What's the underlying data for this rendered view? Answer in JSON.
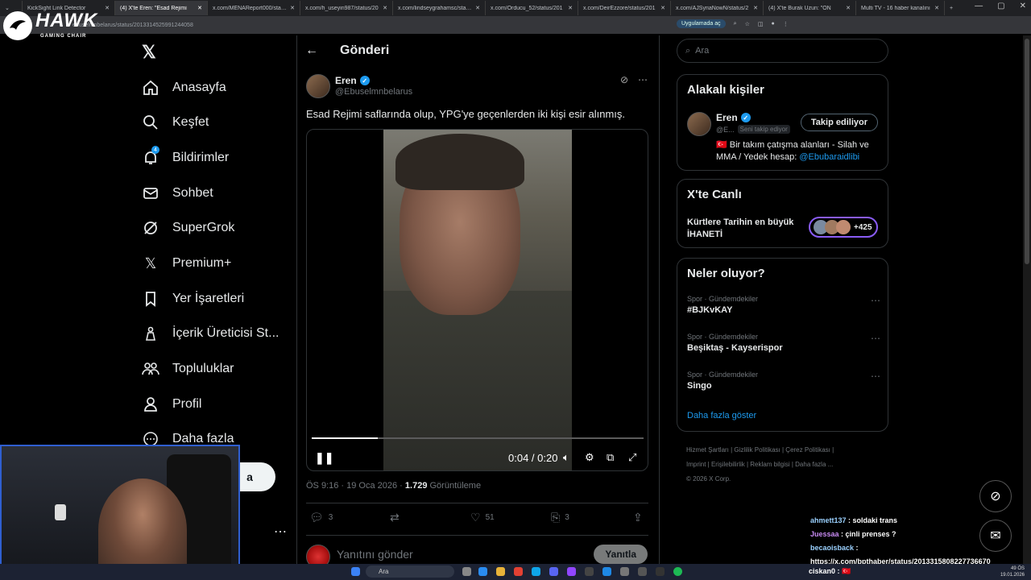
{
  "browser": {
    "tabs": [
      {
        "title": "KickSight Link Detector",
        "active": false
      },
      {
        "title": "(4) X'te Eren: \"Esad Rejimi",
        "active": true
      },
      {
        "title": "x.com/MENAReport000/status",
        "active": false
      },
      {
        "title": "x.com/h_useyin987/status/20",
        "active": false
      },
      {
        "title": "x.com/lindseygrahamsc/status",
        "active": false
      },
      {
        "title": "x.com/Orducu_52/status/201",
        "active": false
      },
      {
        "title": "x.com/DeirEzzore/status/201",
        "active": false
      },
      {
        "title": "x.com/AJSyriaNowN/status/2",
        "active": false
      },
      {
        "title": "(4) X'te Burak Uzun: \"ÖN",
        "active": false
      },
      {
        "title": "Multi TV - 16 haber kanalını",
        "active": false
      }
    ],
    "url": "ebuselmnbelarus/status/2013314525991244058",
    "app_button": "Uygulamada aç"
  },
  "overlay": {
    "brand": "HAWK",
    "brand_sub": "GAMING CHAIR"
  },
  "sidebar": {
    "items": [
      {
        "label": "Anasayfa",
        "icon": "home-icon"
      },
      {
        "label": "Keşfet",
        "icon": "search-icon"
      },
      {
        "label": "Bildirimler",
        "icon": "bell-icon",
        "badge": "4"
      },
      {
        "label": "Sohbet",
        "icon": "mail-icon"
      },
      {
        "label": "SuperGrok",
        "icon": "grok-icon"
      },
      {
        "label": "Premium+",
        "icon": "x-icon"
      },
      {
        "label": "Yer İşaretleri",
        "icon": "bookmark-icon"
      },
      {
        "label": "İçerik Üreticisi St...",
        "icon": "creator-icon"
      },
      {
        "label": "Topluluklar",
        "icon": "communities-icon"
      },
      {
        "label": "Profil",
        "icon": "person-icon"
      },
      {
        "label": "Daha fazla",
        "icon": "more-icon"
      }
    ],
    "post_button": "a"
  },
  "main": {
    "header": "Gönderi",
    "author_name": "Eren",
    "author_handle": "@Ebuselmnbelarus",
    "text": "Esad Rejimi saflarında olup, YPG'ye geçenlerden iki kişi esir alınmış.",
    "video_time": "0:04 / 0:20",
    "video_progress": 0.2,
    "meta_time": "ÖS 9:16 · 19 Oca 2026 · ",
    "views": "1.729",
    "views_label": " Görüntüleme",
    "stats": {
      "replies": "3",
      "reposts": "",
      "likes": "51",
      "bookmarks": "3"
    },
    "reply_placeholder": "Yanıtını gönder",
    "reply_button": "Yanıtla"
  },
  "right": {
    "search_placeholder": "Ara",
    "related": {
      "title": "Alakalı kişiler",
      "name": "Eren",
      "handle": "@E...",
      "follows_you": "Seni takip ediyor",
      "button": "Takip ediliyor",
      "bio": "🇹🇷 Bir takım çatışma alanları - Silah ve MMA / Yedek hesap: ",
      "bio_link": "@Ebubaraidlibi"
    },
    "live": {
      "title": "X'te Canlı",
      "line1": "Kürtlere Tarihin en büyük",
      "line2": "İHANETİ",
      "count": "+425"
    },
    "trends": {
      "title": "Neler oluyor?",
      "items": [
        {
          "category": "Spor · Gündemdekiler",
          "name": "#BJKvKAY"
        },
        {
          "category": "Spor · Gündemdekiler",
          "name": "Beşiktaş - Kayserispor"
        },
        {
          "category": "Spor · Gündemdekiler",
          "name": "Singo"
        }
      ],
      "more": "Daha fazla göster"
    },
    "footer": {
      "l1": "Hizmet Şartları  |  Gizlilik Politikası  |  Çerez Politikası  |",
      "l2": "Imprint  |  Erişilebilirlik  |  Reklam bilgisi  |  Daha fazla ...",
      "l3": "© 2026 X Corp."
    }
  },
  "chat": {
    "messages": [
      {
        "user": "ahmett137",
        "text": " : soldaki trans"
      },
      {
        "user": "Juessaa",
        "text": " : çinli prenses ?"
      },
      {
        "user": "becaoisback",
        "text": " :"
      }
    ],
    "link": "https://x.com/bpthaber/status/2013315808227736670",
    "last_user": "ciskan0",
    "last_text": " : 🇹🇷"
  },
  "taskbar": {
    "search": "Ara",
    "clock_time": "49 ÖS",
    "clock_date": "19.01.2026"
  }
}
